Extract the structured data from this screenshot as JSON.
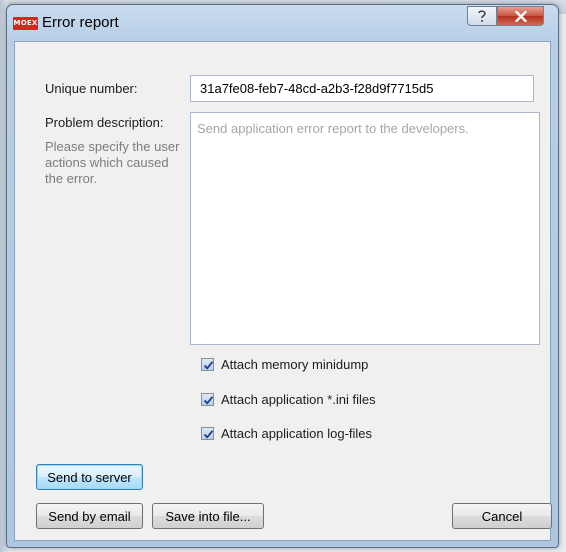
{
  "window": {
    "icon_text": "MOEX",
    "title": "Error report",
    "help_label": "?",
    "close_label": "X"
  },
  "form": {
    "unique_number_label": "Unique number:",
    "unique_number_value": "31a7fe08-feb7-48cd-a2b3-f28d9f7715d5",
    "problem_label": "Problem description:",
    "problem_hint": "Please specify the user actions which caused the error.",
    "problem_placeholder": "Send application error report to the developers."
  },
  "options": [
    {
      "label": "Attach memory minidump",
      "checked": true
    },
    {
      "label": "Attach application *.ini files",
      "checked": true
    },
    {
      "label": "Attach application log-files",
      "checked": true
    }
  ],
  "buttons": {
    "send_server": "Send to server",
    "send_email": "Send by email",
    "save_file": "Save into file...",
    "cancel": "Cancel"
  },
  "colors": {
    "titlebar": "#b7cee6",
    "client_bg": "#f0f0f0",
    "close_button": "#c75442",
    "app_icon": "#d9251d",
    "default_button_border": "#3c7fb1"
  }
}
